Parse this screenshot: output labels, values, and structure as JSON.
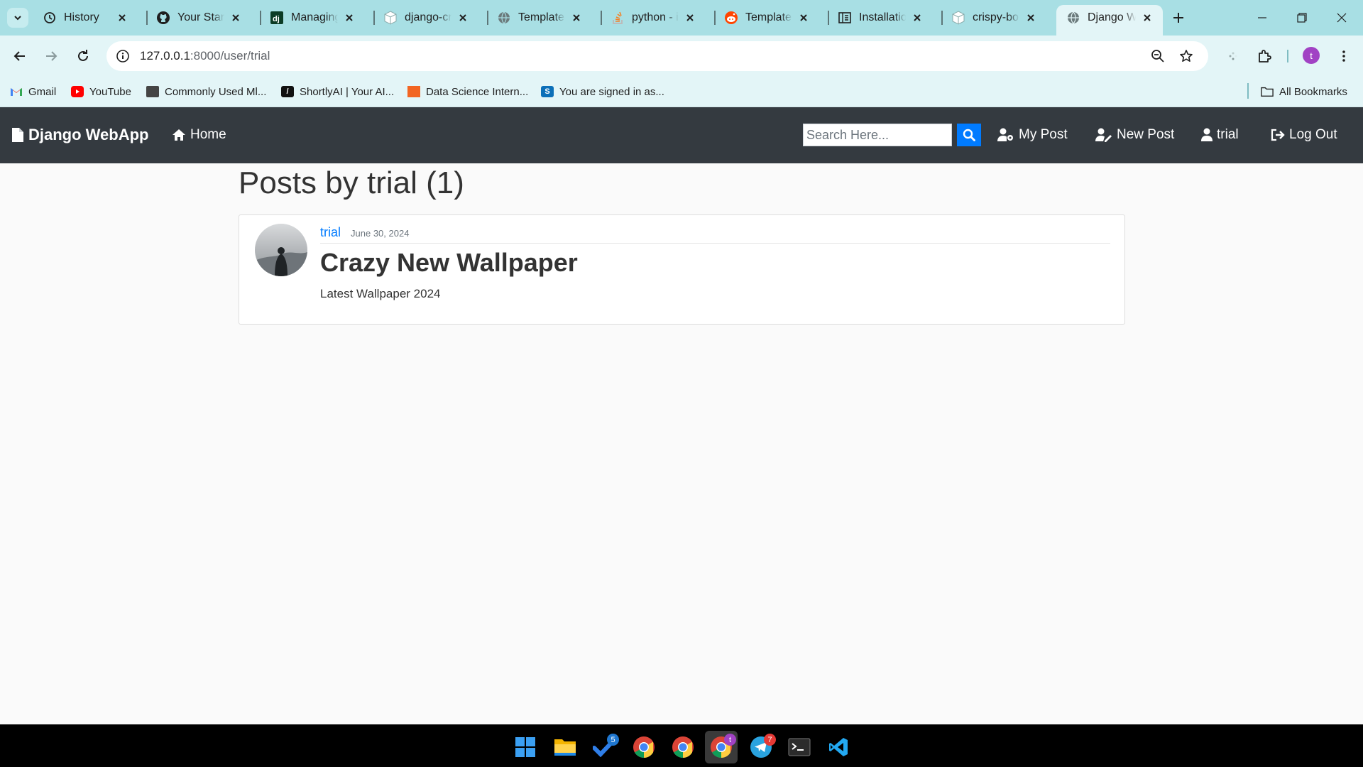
{
  "browser": {
    "tabs": [
      {
        "title": "History",
        "icon": "history-icon"
      },
      {
        "title": "Your Stars",
        "icon": "github-icon"
      },
      {
        "title": "Managing",
        "icon": "django-icon"
      },
      {
        "title": "django-cri",
        "icon": "package-icon"
      },
      {
        "title": "TemplateS",
        "icon": "globe-icon"
      },
      {
        "title": "python - i",
        "icon": "stackoverflow-icon"
      },
      {
        "title": "TemplateD",
        "icon": "reddit-icon"
      },
      {
        "title": "Installation",
        "icon": "docs-icon"
      },
      {
        "title": "crispy-boo",
        "icon": "package-icon"
      },
      {
        "title": "Django W",
        "icon": "globe-icon",
        "active": true
      }
    ],
    "url": {
      "host": "127.0.0.1",
      "path": ":8000/user/trial"
    },
    "profile_initial": "t",
    "bookmarks": [
      {
        "label": "Gmail",
        "icon": "gmail-icon"
      },
      {
        "label": "YouTube",
        "icon": "youtube-icon"
      },
      {
        "label": "Commonly Used Ml...",
        "icon": "monitor-icon"
      },
      {
        "label": "ShortlyAI | Your AI...",
        "icon": "shortlyai-icon"
      },
      {
        "label": "Data Science Intern...",
        "icon": "chart-icon"
      },
      {
        "label": "You are signed in as...",
        "icon": "s-icon"
      }
    ],
    "all_bookmarks": "All Bookmarks"
  },
  "site": {
    "brand": "Django WebApp",
    "home": "Home",
    "search_placeholder": "Search Here...",
    "nav": {
      "my_post": "My Post",
      "new_post": "New Post",
      "user": "trial",
      "logout": "Log Out"
    },
    "colors": {
      "navbar": "#343a40",
      "primary": "#007bff"
    }
  },
  "page": {
    "title": "Posts by trial (1)"
  },
  "posts": [
    {
      "author": "trial",
      "date": "June 30, 2024",
      "title": "Crazy New Wallpaper",
      "content": "Latest Wallpaper 2024"
    }
  ],
  "taskbar": {
    "badges": {
      "todo": "5",
      "chrome_profile": "t",
      "telegram": "7"
    }
  }
}
